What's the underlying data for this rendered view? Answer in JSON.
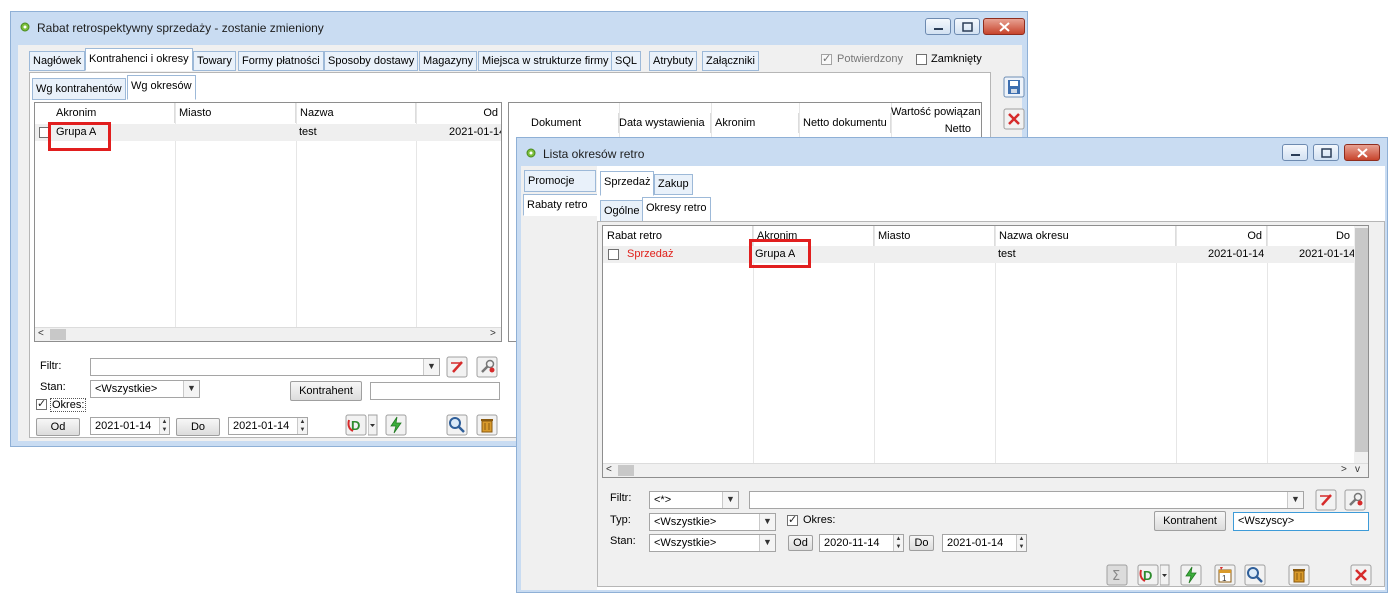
{
  "back_window": {
    "title": "Rabat retrospektywny sprzedaży - zostanie zmieniony",
    "tabs": [
      "Nagłówek",
      "Kontrahenci i okresy",
      "Towary",
      "Formy płatności",
      "Sposoby dostawy",
      "Magazyny",
      "Miejsca w strukturze firmy",
      "SQL",
      "Atrybuty",
      "Załączniki"
    ],
    "confirmed_label": "Potwierdzony",
    "closed_label": "Zamknięty",
    "subtabs": [
      "Wg kontrahentów",
      "Wg okresów"
    ],
    "left_grid": {
      "columns": [
        "Akronim",
        "Miasto",
        "Nazwa",
        "Od"
      ],
      "rows": [
        {
          "akronim": "Grupa A",
          "miasto": "",
          "nazwa": "test",
          "od": "2021-01-14"
        }
      ]
    },
    "right_grid": {
      "columns": [
        "Dokument",
        "Data wystawienia",
        "Akronim",
        "Netto dokumentu",
        "Wartość powiązan",
        "Netto"
      ]
    },
    "filter_label": "Filtr:",
    "filter_value": "",
    "stan_label": "Stan:",
    "stan_value": "<Wszystkie>",
    "kontrahent_button": "Kontrahent",
    "kontrahent_value": "",
    "okres_label": "Okres:",
    "od_button": "Od",
    "od_value": "2021-01-14",
    "do_button": "Do",
    "do_value": "2021-01-14"
  },
  "front_window": {
    "title": "Lista okresów retro",
    "side_tabs": [
      "Promocje",
      "Rabaty retro"
    ],
    "tabs": [
      "Sprzedaż",
      "Zakup"
    ],
    "subtabs": [
      "Ogólne",
      "Okresy retro"
    ],
    "grid": {
      "columns": [
        "Rabat retro",
        "Akronim",
        "Miasto",
        "Nazwa okresu",
        "Od",
        "Do"
      ],
      "rows": [
        {
          "rabat": "Sprzedaż",
          "akronim": "Grupa A",
          "miasto": "",
          "nazwa": "test",
          "od": "2021-01-14",
          "do": "2021-01-14"
        }
      ]
    },
    "filter_label": "Filtr:",
    "filter_select": "<*>",
    "filter_value": "",
    "typ_label": "Typ:",
    "typ_value": "<Wszystkie>",
    "okres_label": "Okres:",
    "stan_label": "Stan:",
    "stan_value": "<Wszystkie>",
    "od_button": "Od",
    "od_value": "2020-11-14",
    "do_button": "Do",
    "do_value": "2021-01-14",
    "kontrahent_button": "Kontrahent",
    "kontrahent_value": "<Wszyscy>"
  },
  "colors": {
    "highlight": "#e11e1e",
    "link_red": "#e0201a",
    "window_frame": "#c9dcf2"
  }
}
